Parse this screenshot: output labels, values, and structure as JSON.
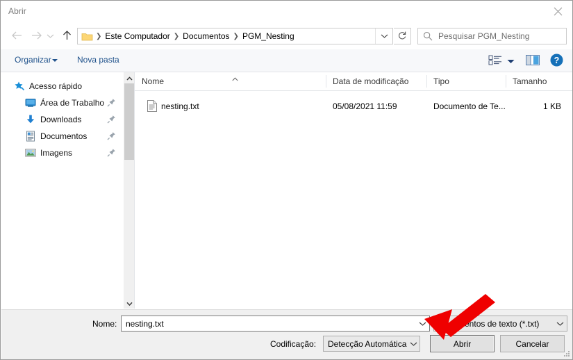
{
  "window": {
    "title": "Abrir",
    "close_icon": "close-icon"
  },
  "nav": {
    "back_icon": "arrow-left-icon",
    "forward_icon": "arrow-right-icon",
    "recent_icon": "chevron-down-icon",
    "up_icon": "arrow-up-icon",
    "refresh_icon": "refresh-icon",
    "folder_icon": "folder-icon",
    "breadcrumbs": [
      {
        "label": "Este Computador"
      },
      {
        "label": "Documentos"
      },
      {
        "label": "PGM_Nesting"
      }
    ],
    "address_chevron_icon": "chevron-down-icon"
  },
  "search": {
    "placeholder": "Pesquisar PGM_Nesting",
    "icon": "search-icon"
  },
  "commandbar": {
    "organize_label": "Organizar",
    "organize_caret_icon": "caret-down-icon",
    "new_folder_label": "Nova pasta",
    "view_icon": "view-list-icon",
    "view_caret_icon": "caret-down-icon",
    "preview_pane_icon": "preview-pane-icon",
    "help_icon": "help-icon"
  },
  "sidebar": {
    "items": [
      {
        "label": "Acesso rápido",
        "icon": "star-pin-icon",
        "level": "root",
        "pinned": false
      },
      {
        "label": "Área de Trabalho",
        "icon": "desktop-icon",
        "level": "child",
        "pinned": true
      },
      {
        "label": "Downloads",
        "icon": "download-arrow-icon",
        "level": "child",
        "pinned": true
      },
      {
        "label": "Documentos",
        "icon": "documents-icon",
        "level": "child",
        "pinned": true
      },
      {
        "label": "Imagens",
        "icon": "pictures-icon",
        "level": "child",
        "pinned": true
      }
    ],
    "scrollbar": {
      "up_icon": "chevron-up-icon",
      "down_icon": "chevron-down-icon"
    }
  },
  "filelist": {
    "columns": [
      {
        "label": "Nome",
        "sorted": "asc"
      },
      {
        "label": "Data de modificação",
        "sorted": ""
      },
      {
        "label": "Tipo",
        "sorted": ""
      },
      {
        "label": "Tamanho",
        "sorted": ""
      }
    ],
    "rows": [
      {
        "name": "nesting.txt",
        "modified": "05/08/2021 11:59",
        "type": "Documento de Te...",
        "size": "1 KB",
        "icon": "text-file-icon"
      }
    ]
  },
  "bottom": {
    "name_label": "Nome:",
    "name_value": "nesting.txt",
    "name_chevron_icon": "chevron-down-icon",
    "filter_value": "Documentos de texto (*.txt)",
    "filter_chevron_icon": "chevron-down-icon",
    "encoding_label": "Codificação:",
    "encoding_value": "Detecção Automática",
    "encoding_chevron_icon": "chevron-down-icon",
    "open_button": "Abrir",
    "cancel_button": "Cancelar",
    "resize_grip_icon": "resize-grip-icon"
  },
  "annotation": {
    "arrow_icon": "red-arrow-icon",
    "color": "#ef0000",
    "points_at": "Abrir"
  }
}
